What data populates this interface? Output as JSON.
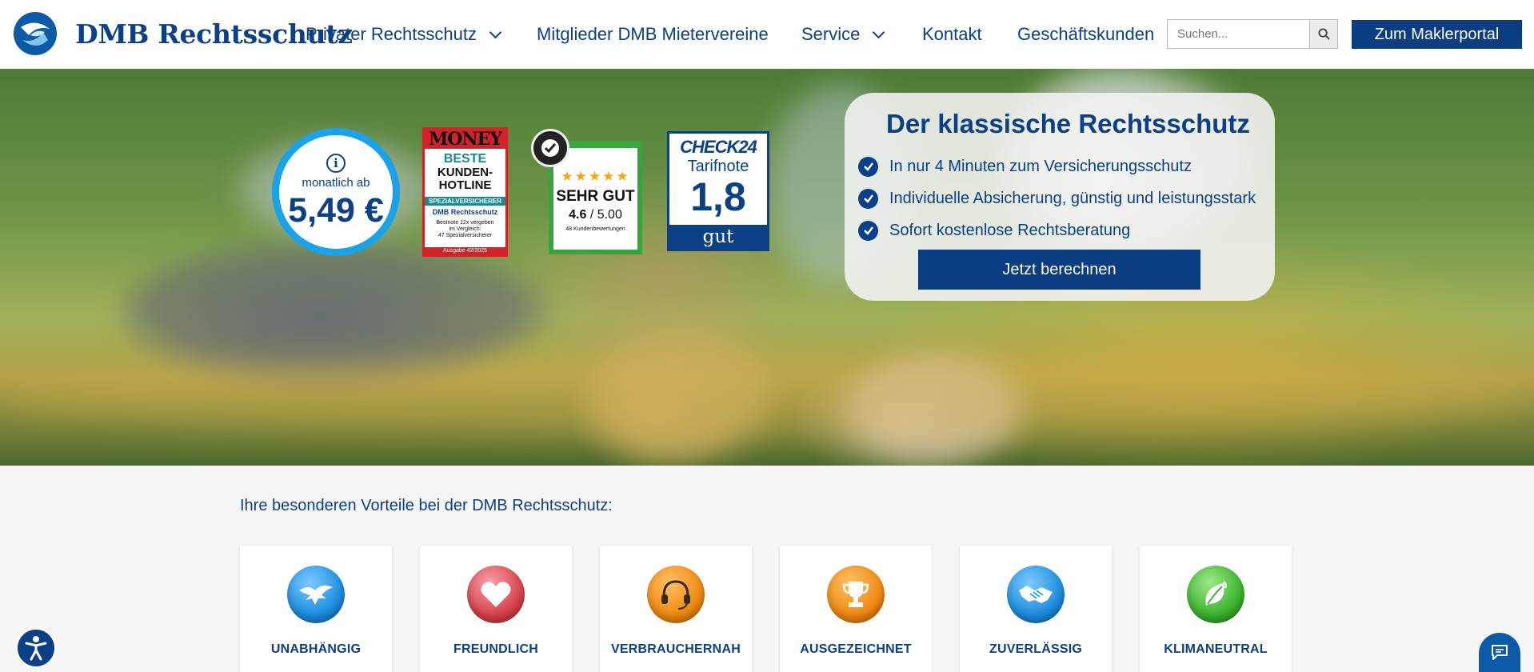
{
  "header": {
    "logo_text": "DMB Rechtsschutz",
    "nav": [
      {
        "label": "Privater Rechtsschutz",
        "dropdown": true
      },
      {
        "label": "Mitglieder DMB Mietervereine",
        "dropdown": false
      },
      {
        "label": "Service",
        "dropdown": true
      },
      {
        "label": "Kontakt",
        "dropdown": false
      },
      {
        "label": "Geschäftskunden",
        "dropdown": false
      }
    ],
    "search": {
      "placeholder": "Suchen...",
      "value": ""
    },
    "makler_label": "Zum Maklerportal"
  },
  "hero": {
    "price": {
      "label": "monatlich ab",
      "value": "5,49 €"
    },
    "money_award": {
      "brand": "MONEY",
      "line1": "BESTE",
      "line2": "KUNDEN-",
      "line3": "HOTLINE",
      "category": "SPEZIALVERSICHERER",
      "company": "DMB Rechtsschutz",
      "detail1": "Bestnote 12x vergeben",
      "detail2": "im Vergleich:",
      "detail3": "47 Spezialversicherer",
      "issue": "Ausgabe 42/2025"
    },
    "rating": {
      "stars": "★★★★★",
      "verdict": "SEHR GUT",
      "score": "4.6",
      "score_max": " / 5.00",
      "reviews": "48 Kundenbewertungen"
    },
    "check24": {
      "logo": "CHECK24",
      "label": "Tarifnote",
      "note": "1,8",
      "grade": "gut"
    },
    "promo": {
      "title": "Der klassische Rechtsschutz",
      "items": [
        "In nur 4 Minuten zum Versicherungsschutz",
        "Individuelle Absicherung, günstig und leistungsstark",
        "Sofort kostenlose Rechtsberatung"
      ],
      "cta": "Jetzt berechnen"
    }
  },
  "benefits": {
    "title": "Ihre besonderen Vorteile bei der DMB Rechtsschutz:",
    "cards": [
      {
        "label": "UNABHÄNGIG",
        "icon": "eagle-icon",
        "color": "#1e8fe0"
      },
      {
        "label": "FREUNDLICH",
        "icon": "heart-icon",
        "color": "#d9434e"
      },
      {
        "label": "VERBRAUCHERNAH",
        "icon": "headset-icon",
        "color": "#f08a12"
      },
      {
        "label": "AUSGEZEICHNET",
        "icon": "trophy-icon",
        "color": "#f08a12"
      },
      {
        "label": "ZUVERLÄSSIG",
        "icon": "handshake-icon",
        "color": "#1e8fe0"
      },
      {
        "label": "KLIMANEUTRAL",
        "icon": "leaf-icon",
        "color": "#3cb52f"
      }
    ]
  },
  "colors": {
    "brand": "#0b3f86",
    "accent": "#1aa3e8",
    "button": "#0b3d82"
  }
}
